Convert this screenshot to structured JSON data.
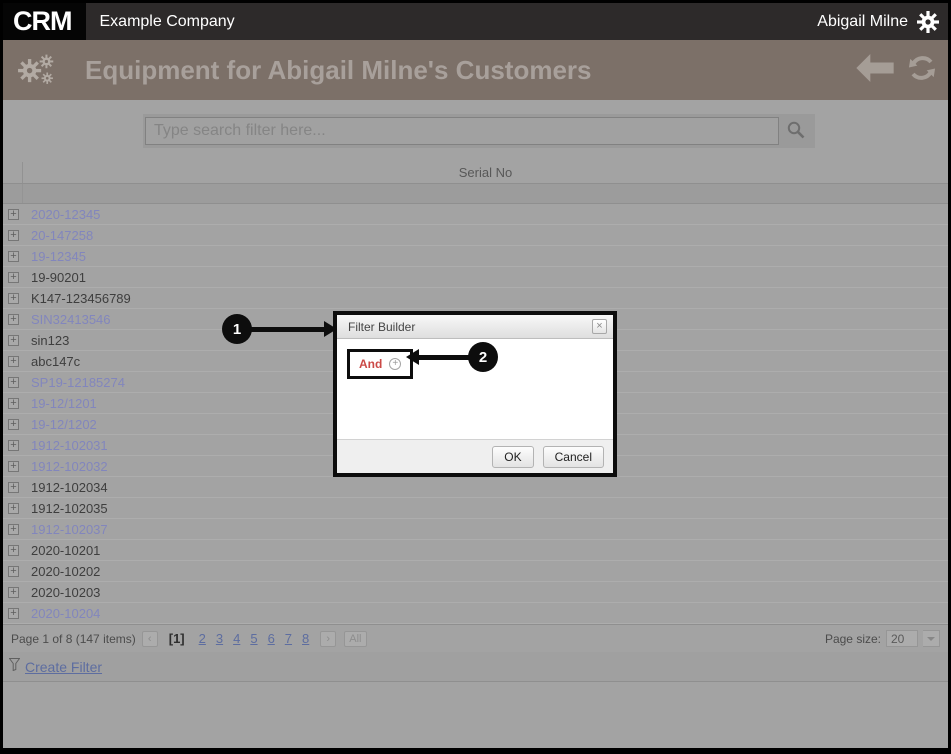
{
  "topbar": {
    "logo": "CRM",
    "company": "Example Company",
    "user": "Abigail Milne"
  },
  "header": {
    "title": "Equipment for Abigail Milne's Customers"
  },
  "search": {
    "placeholder": "Type search filter here...",
    "value": ""
  },
  "table": {
    "column_header": "Serial No",
    "rows": [
      {
        "serial": "2020-12345",
        "link": true
      },
      {
        "serial": "20-147258",
        "link": true
      },
      {
        "serial": "19-12345",
        "link": true
      },
      {
        "serial": "19-90201",
        "link": false
      },
      {
        "serial": "K147-123456789",
        "link": false
      },
      {
        "serial": "SIN32413546",
        "link": true
      },
      {
        "serial": "sin123",
        "link": false
      },
      {
        "serial": "abc147c",
        "link": false
      },
      {
        "serial": "SP19-12185274",
        "link": true
      },
      {
        "serial": "19-12/1201",
        "link": true
      },
      {
        "serial": "19-12/1202",
        "link": true
      },
      {
        "serial": "1912-102031",
        "link": true
      },
      {
        "serial": "1912-102032",
        "link": true
      },
      {
        "serial": "1912-102034",
        "link": false
      },
      {
        "serial": "1912-102035",
        "link": false
      },
      {
        "serial": "1912-102037",
        "link": true
      },
      {
        "serial": "2020-10201",
        "link": false
      },
      {
        "serial": "2020-10202",
        "link": false
      },
      {
        "serial": "2020-10203",
        "link": false
      },
      {
        "serial": "2020-10204",
        "link": true
      }
    ]
  },
  "pager": {
    "summary": "Page 1 of 8 (147 items)",
    "prev_glyph": "‹",
    "current_page": "[1]",
    "pages": [
      "2",
      "3",
      "4",
      "5",
      "6",
      "7",
      "8"
    ],
    "next_glyph": "›",
    "all_label": "All",
    "page_size_label": "Page size:",
    "page_size_value": "20"
  },
  "filter_bar": {
    "create_filter_label": "Create Filter"
  },
  "dialog": {
    "title": "Filter Builder",
    "close_glyph": "×",
    "and_label": "And",
    "ok_label": "OK",
    "cancel_label": "Cancel"
  },
  "annotations": {
    "callout1": "1",
    "callout2": "2"
  },
  "colors": {
    "topbar_bg": "#2d2a2a",
    "header_bg": "#7c7068",
    "page_overlay_gray": "#a3a3a3",
    "serial_link": "#8286bd",
    "pager_link": "#5d6da0",
    "and_red": "#cb4946",
    "annotation_black": "#0d0d0d"
  }
}
